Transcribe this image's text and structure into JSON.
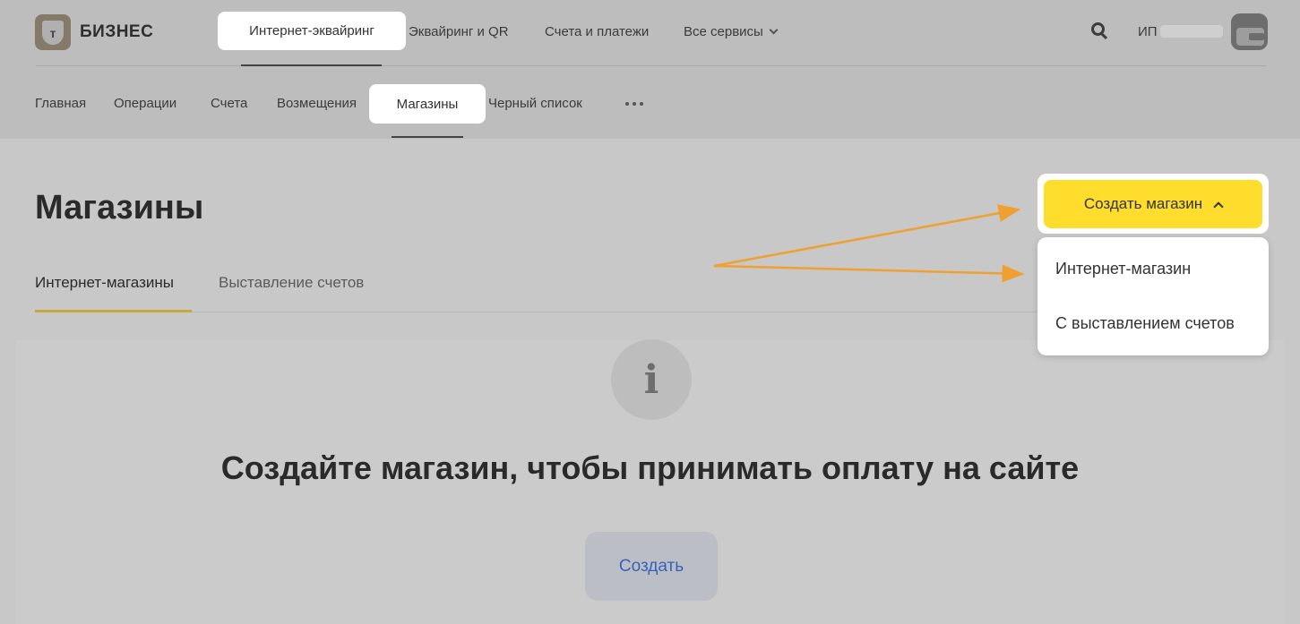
{
  "logo": {
    "mark": "т",
    "text": "БИЗНЕС"
  },
  "top_nav": {
    "active": "Интернет-эквайринг",
    "items": [
      "Эквайринг и QR",
      "Счета и платежи",
      "Все сервисы"
    ]
  },
  "user": {
    "label": "ИП"
  },
  "sub_nav": {
    "items": [
      "Главная",
      "Операции",
      "Счета",
      "Возмещения"
    ],
    "active": "Магазины",
    "after": "Черный список"
  },
  "page": {
    "title": "Магазины"
  },
  "tabs": [
    "Интернет-магазины",
    "Выставление счетов"
  ],
  "empty_state": {
    "icon_glyph": "i",
    "title": "Создайте магазин, чтобы принимать оплату на сайте",
    "button": "Создать"
  },
  "create_menu": {
    "button_label": "Создать магазин",
    "items": [
      "Интернет-магазин",
      "С выставлением счетов"
    ]
  },
  "colors": {
    "accent": "#ffdd2d",
    "arrow": "#f0a030",
    "link": "#3563b8"
  }
}
